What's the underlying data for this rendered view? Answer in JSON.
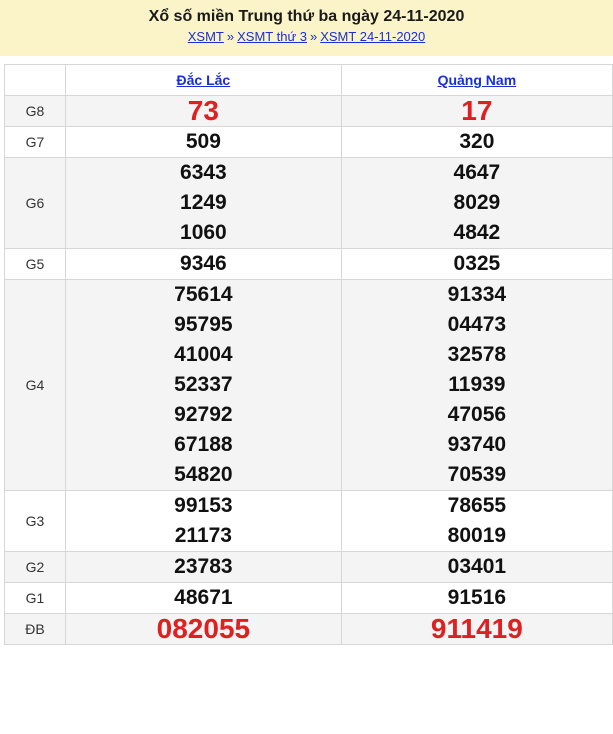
{
  "header": {
    "title": "Xổ số miền Trung thứ ba ngày 24-11-2020",
    "breadcrumb": [
      {
        "label": "XSMT"
      },
      {
        "label": "XSMT thứ 3"
      },
      {
        "label": "XSMT 24-11-2020"
      }
    ],
    "separator": "»"
  },
  "table": {
    "provinces": [
      "Đắc Lắc",
      "Quảng Nam"
    ],
    "rows": [
      {
        "label": "G8",
        "col1": [
          "73"
        ],
        "col2": [
          "17"
        ]
      },
      {
        "label": "G7",
        "col1": [
          "509"
        ],
        "col2": [
          "320"
        ]
      },
      {
        "label": "G6",
        "col1": [
          "6343",
          "1249",
          "1060"
        ],
        "col2": [
          "4647",
          "8029",
          "4842"
        ]
      },
      {
        "label": "G5",
        "col1": [
          "9346"
        ],
        "col2": [
          "0325"
        ]
      },
      {
        "label": "G4",
        "col1": [
          "75614",
          "95795",
          "41004",
          "52337",
          "92792",
          "67188",
          "54820"
        ],
        "col2": [
          "91334",
          "04473",
          "32578",
          "11939",
          "47056",
          "93740",
          "70539"
        ]
      },
      {
        "label": "G3",
        "col1": [
          "99153",
          "21173"
        ],
        "col2": [
          "78655",
          "80019"
        ]
      },
      {
        "label": "G2",
        "col1": [
          "23783"
        ],
        "col2": [
          "03401"
        ]
      },
      {
        "label": "G1",
        "col1": [
          "48671"
        ],
        "col2": [
          "91516"
        ]
      },
      {
        "label": "ĐB",
        "col1": [
          "082055"
        ],
        "col2": [
          "911419"
        ]
      }
    ]
  },
  "colors": {
    "highlight": "#e02020",
    "link": "#1a2fd6",
    "header_bg": "#fbf4c8"
  }
}
